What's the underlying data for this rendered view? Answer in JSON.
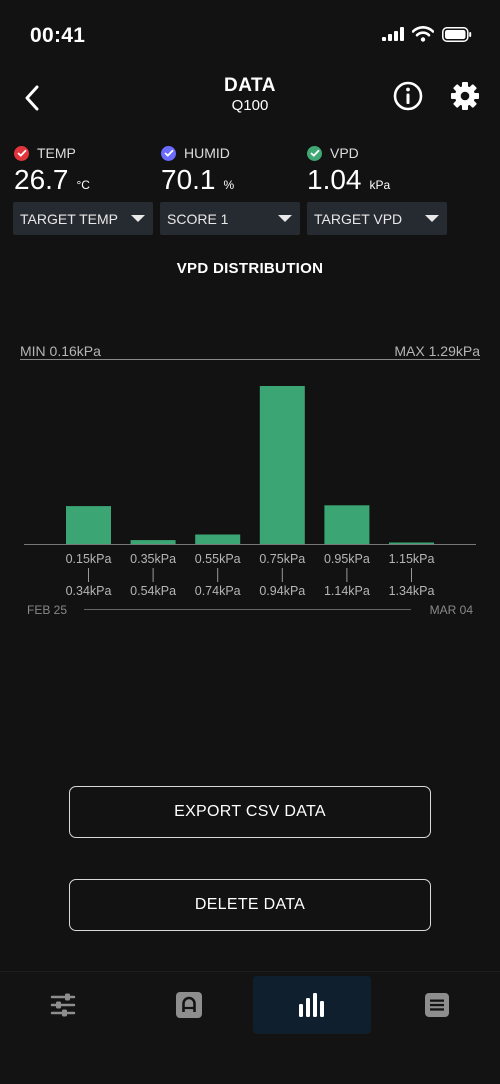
{
  "status_bar": {
    "time": "00:41"
  },
  "header": {
    "title": "DATA",
    "subtitle": "Q100"
  },
  "metrics": [
    {
      "label": "TEMP",
      "value": "26.7",
      "unit": "°C",
      "check_color": "#e0353c"
    },
    {
      "label": "HUMID",
      "value": "70.1",
      "unit": "%",
      "check_color": "#6a6bff"
    },
    {
      "label": "VPD",
      "value": "1.04",
      "unit": "kPa",
      "check_color": "#3fa873"
    }
  ],
  "dropdowns": [
    {
      "selected": "TARGET TEMP"
    },
    {
      "selected": "SCORE 1"
    },
    {
      "selected": "TARGET VPD"
    }
  ],
  "chart_title": "VPD DISTRIBUTION",
  "chart_data": {
    "type": "bar",
    "title": "VPD DISTRIBUTION",
    "min_label": "MIN 0.16kPa",
    "max_label": "MAX 1.29kPa",
    "bar_color": "#3ba674",
    "categories": [
      {
        "low": "0.15kPa",
        "high": "0.34kPa"
      },
      {
        "low": "0.35kPa",
        "high": "0.54kPa"
      },
      {
        "low": "0.55kPa",
        "high": "0.74kPa"
      },
      {
        "low": "0.75kPa",
        "high": "0.94kPa"
      },
      {
        "low": "0.95kPa",
        "high": "1.14kPa"
      },
      {
        "low": "1.15kPa",
        "high": "1.34kPa"
      }
    ],
    "values": [
      24,
      2.5,
      6,
      100,
      24.5,
      0.6
    ],
    "ylim": [
      0,
      100
    ],
    "date_start": "FEB 25",
    "date_end": "MAR 04"
  },
  "buttons": {
    "export": "EXPORT CSV DATA",
    "delete": "DELETE DATA"
  },
  "tabs": [
    {
      "icon": "sliders-icon",
      "active": false
    },
    {
      "icon": "device-icon",
      "active": false
    },
    {
      "icon": "bar-chart-icon",
      "active": true
    },
    {
      "icon": "list-icon",
      "active": false
    }
  ],
  "colors": {
    "background": "#121212",
    "dropdown_bg": "#262a31",
    "active_tab_bg": "#0f1f2e",
    "muted_text": "#b5b5b5"
  }
}
